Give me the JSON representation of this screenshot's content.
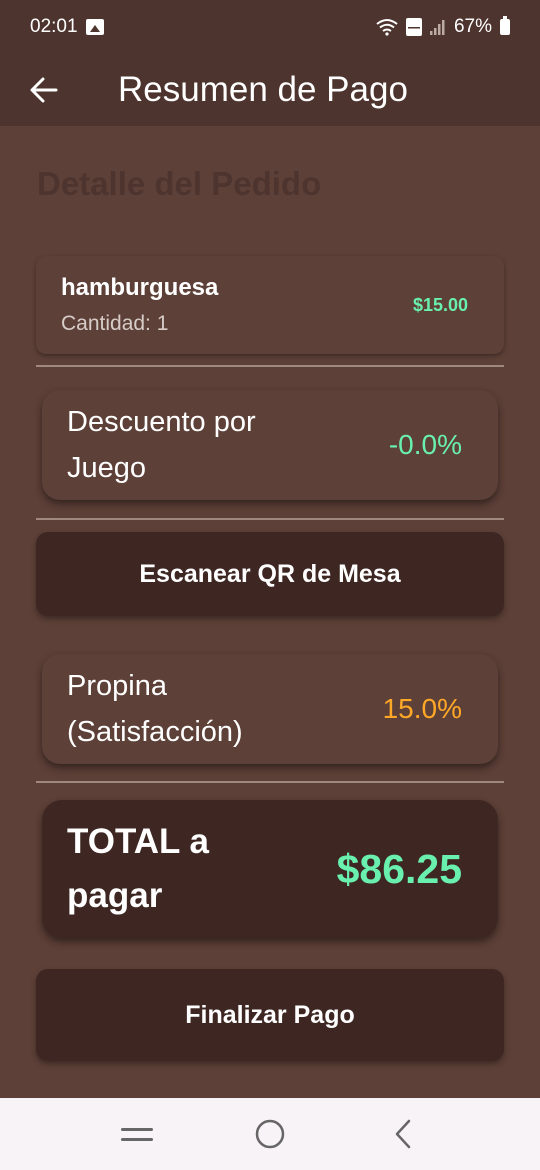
{
  "status_bar": {
    "time": "02:01",
    "battery": "67%"
  },
  "app_bar": {
    "title": "Resumen de Pago",
    "back_icon": "arrow-left-icon"
  },
  "section_title": "Detalle del Pedido",
  "order_item": {
    "name": "hamburguesa",
    "quantity": "Cantidad: 1",
    "price": "$15.00"
  },
  "discount": {
    "label": "Descuento por Juego",
    "value": "-0.0%"
  },
  "scan_button": {
    "label": "Escanear QR de Mesa"
  },
  "tip": {
    "label": "Propina (Satisfacción)",
    "value": "15.0%"
  },
  "total": {
    "label": "TOTAL a pagar",
    "value": "$86.25"
  },
  "finish_button": {
    "label": "Finalizar Pago"
  },
  "colors": {
    "background": "#5d4037",
    "app_bar": "#4e342e",
    "button": "#3e2723",
    "accent_green": "#69f0ae",
    "accent_orange": "#ffa726"
  }
}
